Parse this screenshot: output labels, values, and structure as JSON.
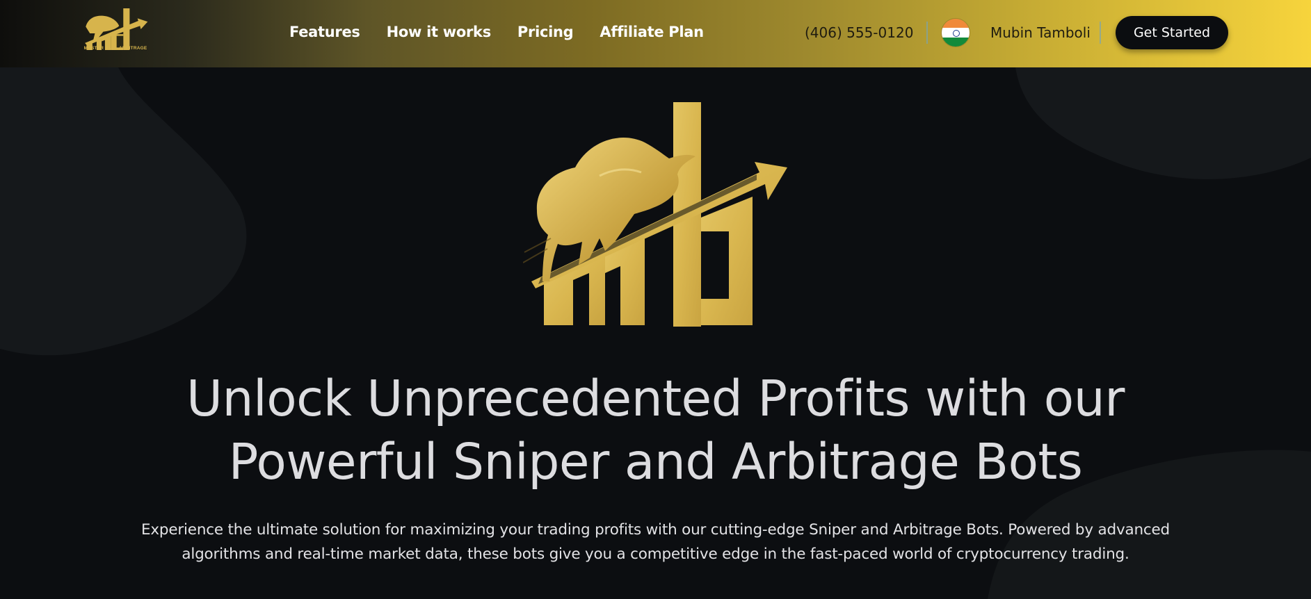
{
  "header": {
    "logo_caption": "MASTER BULL ARBITRAGE",
    "nav": [
      "Features",
      "How it works",
      "Pricing",
      "Affiliate Plan"
    ],
    "phone": "(406) 555-0120",
    "user_name": "Mubin Tamboli",
    "flag_icon": "india-flag-icon",
    "cta_label": "Get Started"
  },
  "hero": {
    "logo_icon": "bull-chart-logo-icon",
    "title_line1": "Unlock Unprecedented Profits with our",
    "title_line2": "Powerful Sniper and Arbitrage Bots",
    "subtitle_line1": "Experience the ultimate solution for maximizing your trading profits with our cutting-edge Sniper and Arbitrage Bots. Powered by advanced",
    "subtitle_line2": "algorithms and real-time market data, these bots give you a competitive edge in the fast-paced world of cryptocurrency trading."
  },
  "colors": {
    "brand_gold": "#e0bd5a",
    "background": "#0c0e11",
    "cta_background": "#0b0d10"
  }
}
